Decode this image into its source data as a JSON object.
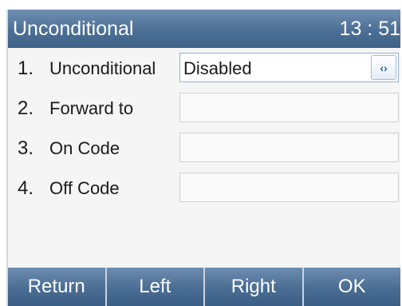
{
  "header": {
    "title": "Unconditional",
    "time": "13 : 51"
  },
  "rows": [
    {
      "num": "1.",
      "label": "Unconditional",
      "value": "Disabled",
      "selected": true
    },
    {
      "num": "2.",
      "label": "Forward to",
      "value": ""
    },
    {
      "num": "3.",
      "label": "On Code",
      "value": ""
    },
    {
      "num": "4.",
      "label": "Off Code",
      "value": ""
    }
  ],
  "softkeys": [
    "Return",
    "Left",
    "Right",
    "OK"
  ],
  "icons": {
    "selector": "left-right-arrows-icon"
  },
  "colors": {
    "bar": "#4c6f95",
    "selected_border": "#8fb0d6"
  }
}
